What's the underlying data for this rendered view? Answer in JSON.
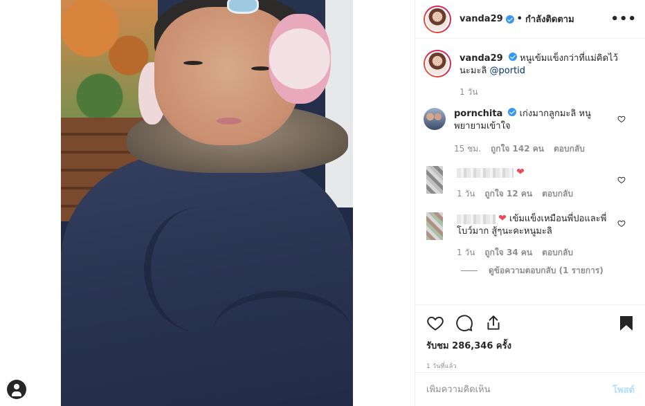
{
  "post": {
    "author": "vanda29",
    "follow_state": "กำลังติดตาม",
    "more_icon": "more-horizontal-icon",
    "verified_color": "#3897f0"
  },
  "caption": {
    "user": "vanda29",
    "text": "หนูเข้มแข็งกว่าที่แม่คิดไว้นะมะลิ",
    "mention": "@portid",
    "time": "1 วัน"
  },
  "comments": [
    {
      "user": "pornchita",
      "verified": true,
      "text": "เก่งมากลูกมะลิ หนูพยายามเข้าใจ",
      "time": "15 ชม.",
      "likes": "ถูกใจ 142 คน",
      "reply_label": "ตอบกลับ"
    },
    {
      "user": "",
      "blurred": true,
      "text": "",
      "emoji": "❤",
      "time": "1 วัน",
      "likes": "ถูกใจ 12 คน",
      "reply_label": "ตอบกลับ"
    },
    {
      "user": "",
      "blurred": true,
      "emoji": "❤",
      "text": "เข้มแข็งเหมือนพี่ปอและพี่โบว์มาก สู้ๆนะคะหนูมะลิ",
      "time": "1 วัน",
      "likes": "ถูกใจ 34 คน",
      "reply_label": "ตอบกลับ",
      "view_replies": "ดูข้อความตอบกลับ (1 รายการ)"
    }
  ],
  "actions": {
    "like_icon": "heart-outline-icon",
    "comment_icon": "comment-icon",
    "share_icon": "share-icon",
    "save_icon": "bookmark-filled-icon"
  },
  "stats": {
    "views_label": "รับชม",
    "views_count": "286,346",
    "views_suffix": "ครั้ง",
    "time_ago": "1 วันที่แล้ว"
  },
  "comment_box": {
    "placeholder": "เพิ่มความคิดเห็น",
    "post_label": "โพสต์"
  },
  "colors": {
    "accent_blue": "#3897f0",
    "heart_red": "#ed4956",
    "disabled_post": "#b2dffc",
    "muted_text": "#8e8e8e"
  }
}
